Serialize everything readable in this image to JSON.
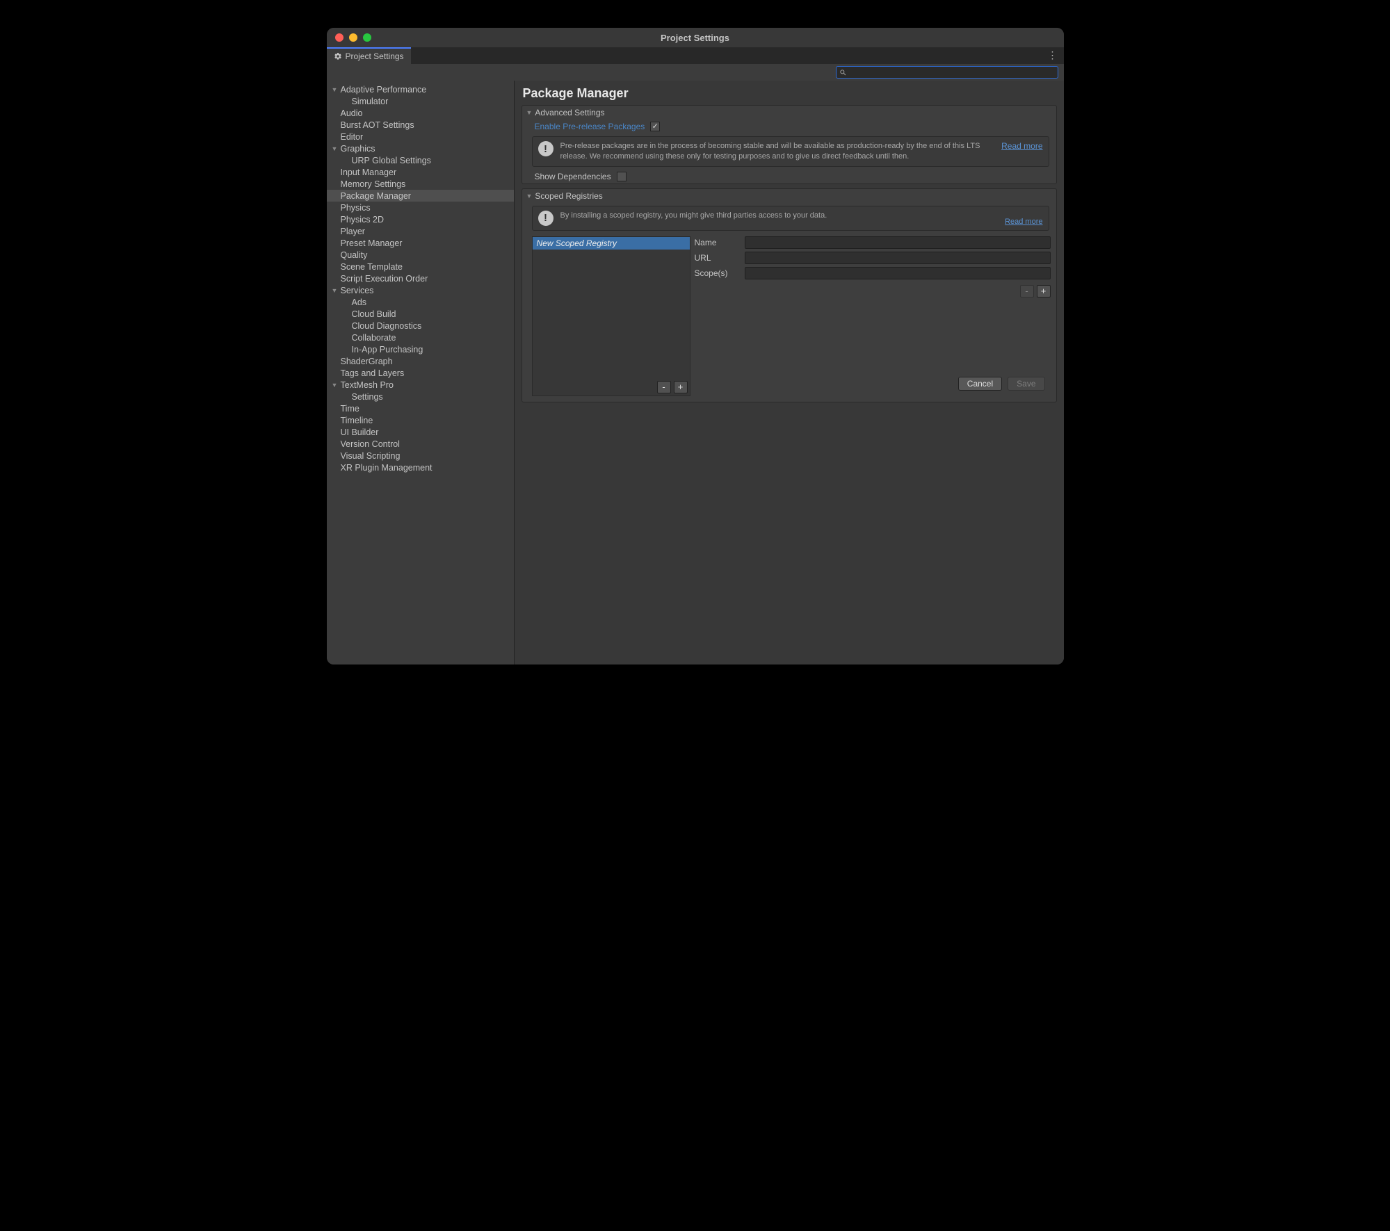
{
  "window": {
    "title": "Project Settings"
  },
  "tab": {
    "label": "Project Settings"
  },
  "search": {
    "value": ""
  },
  "sidebar": [
    {
      "label": "Adaptive Performance",
      "fold": true
    },
    {
      "label": "Simulator",
      "child": true
    },
    {
      "label": "Audio"
    },
    {
      "label": "Burst AOT Settings"
    },
    {
      "label": "Editor"
    },
    {
      "label": "Graphics",
      "fold": true
    },
    {
      "label": "URP Global Settings",
      "child": true
    },
    {
      "label": "Input Manager"
    },
    {
      "label": "Memory Settings"
    },
    {
      "label": "Package Manager",
      "selected": true
    },
    {
      "label": "Physics"
    },
    {
      "label": "Physics 2D"
    },
    {
      "label": "Player"
    },
    {
      "label": "Preset Manager"
    },
    {
      "label": "Quality"
    },
    {
      "label": "Scene Template"
    },
    {
      "label": "Script Execution Order"
    },
    {
      "label": "Services",
      "fold": true
    },
    {
      "label": "Ads",
      "child": true
    },
    {
      "label": "Cloud Build",
      "child": true
    },
    {
      "label": "Cloud Diagnostics",
      "child": true
    },
    {
      "label": "Collaborate",
      "child": true
    },
    {
      "label": "In-App Purchasing",
      "child": true
    },
    {
      "label": "ShaderGraph"
    },
    {
      "label": "Tags and Layers"
    },
    {
      "label": "TextMesh Pro",
      "fold": true
    },
    {
      "label": "Settings",
      "child": true
    },
    {
      "label": "Time"
    },
    {
      "label": "Timeline"
    },
    {
      "label": "UI Builder"
    },
    {
      "label": "Version Control"
    },
    {
      "label": "Visual Scripting"
    },
    {
      "label": "XR Plugin Management"
    }
  ],
  "main": {
    "heading": "Package Manager",
    "advanced": {
      "title": "Advanced Settings",
      "prerelease_label": "Enable Pre-release Packages",
      "prerelease_checked": true,
      "info": "Pre-release packages are in the process of becoming stable and will be available as production-ready by the end of this LTS release. We recommend using these only for testing purposes and to give us direct feedback until then.",
      "read_more": "Read more",
      "show_deps_label": "Show Dependencies",
      "show_deps_checked": false
    },
    "scoped": {
      "title": "Scoped Registries",
      "info": "By installing a scoped registry, you might give third parties access to your data.",
      "read_more": "Read more",
      "new_label": "New Scoped Registry",
      "name_label": "Name",
      "url_label": "URL",
      "scope_label": "Scope(s)",
      "minus": "-",
      "plus": "+",
      "cancel": "Cancel",
      "save": "Save"
    }
  }
}
